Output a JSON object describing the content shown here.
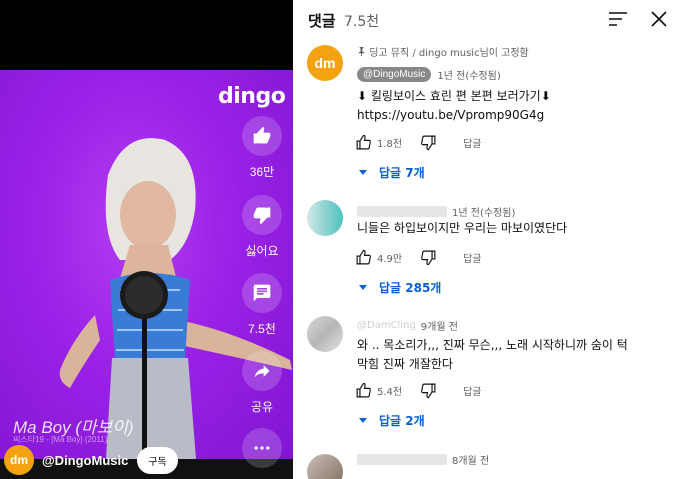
{
  "video": {
    "brand_logo": "dingo",
    "song_title": "Ma Boy (마보이)",
    "song_subtitle": "씨스타19 - [Ma Boy] (2011)",
    "actions": [
      {
        "name": "like",
        "icon": "thumb-up-icon",
        "label": "36만"
      },
      {
        "name": "dislike",
        "icon": "thumb-down-icon",
        "label": "싫어요"
      },
      {
        "name": "comments",
        "icon": "comment-icon",
        "label": "7.5천"
      },
      {
        "name": "share",
        "icon": "share-icon",
        "label": "공유"
      },
      {
        "name": "more",
        "icon": "more-icon",
        "label": ""
      }
    ],
    "channel": {
      "avatar_text": "dm",
      "name": "@DingoMusic",
      "subscribe_label": "구독"
    },
    "colors": {
      "background": "#9a21e6",
      "avatar": "#f2a30f"
    }
  },
  "panel": {
    "title": "댓글",
    "count": "7.5천",
    "sort_icon": "sort-icon",
    "close_icon": "close-icon"
  },
  "comments": [
    {
      "pinned_by": "딩고 뮤직 / dingo music님이 고정함",
      "author": "@DingoMusic",
      "avatar_text": "dm",
      "time": "1년 전(수정됨)",
      "lines": [
        "⬇ 킬링보이스 효린 편 본편 보러가기⬇",
        "https://youtu.be/Vpromp90G4g"
      ],
      "likes": "1.8천",
      "reply_label": "답글",
      "replies_label": "답글 7개"
    },
    {
      "author": "",
      "time": "1년 전(수정됨)",
      "lines": [
        "니들은 하입보이지만 우리는 마보이였단다"
      ],
      "likes": "4.9만",
      "reply_label": "답글",
      "replies_label": "답글 285개"
    },
    {
      "author": "@DamCling",
      "time": "9개월 전",
      "lines": [
        "와 .. 목소리가,,, 진짜 무슨,,, 노래 시작하니까 숨이 턱",
        "막힘 진짜 개잘한다"
      ],
      "likes": "5.4천",
      "reply_label": "답글",
      "replies_label": "답글 2개"
    },
    {
      "author": "",
      "time": "8개월 전",
      "lines": [],
      "likes": "",
      "reply_label": "",
      "replies_label": ""
    }
  ],
  "accent": {
    "link": "#065fd4",
    "muted": "#606060"
  }
}
